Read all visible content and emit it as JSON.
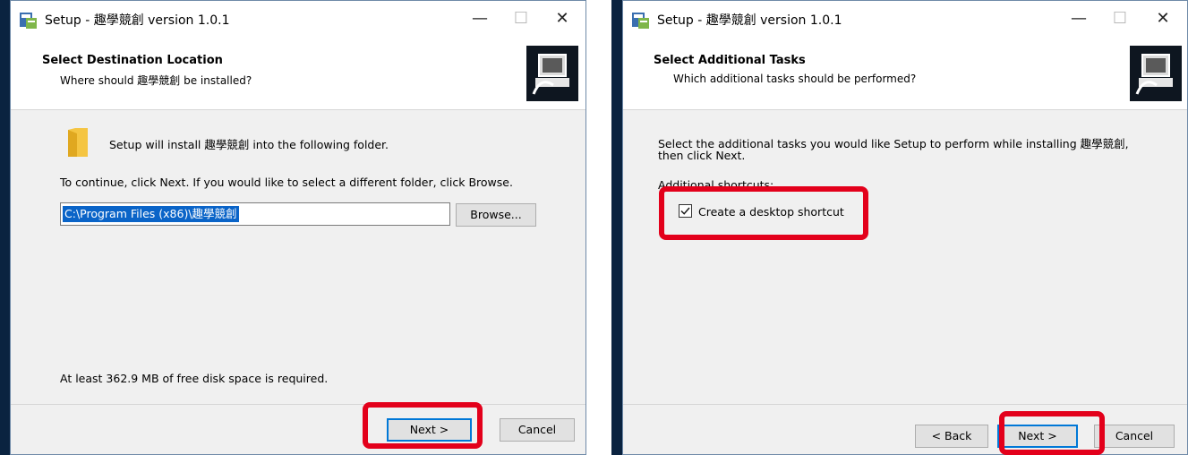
{
  "left": {
    "title": "Setup - 趣學競創 version 1.0.1",
    "controls": {
      "minimize": "—",
      "maximize": "☐",
      "close": "✕"
    },
    "header_title": "Select Destination Location",
    "header_subtitle": "Where should 趣學競創 be installed?",
    "install_text": "Setup will install 趣學競創 into the following folder.",
    "continue_text": "To continue, click Next. If you would like to select a different folder, click Browse.",
    "path_value": "C:\\Program Files (x86)\\趣學競創",
    "browse_label": "Browse...",
    "disk_space_text": "At least 362.9 MB of free disk space is required.",
    "next_label": "Next >",
    "cancel_label": "Cancel"
  },
  "right": {
    "title": "Setup - 趣學競創 version 1.0.1",
    "controls": {
      "minimize": "—",
      "maximize": "☐",
      "close": "✕"
    },
    "header_title": "Select Additional Tasks",
    "header_subtitle": "Which additional tasks should be performed?",
    "tasks_text_line1": "Select the additional tasks you would like Setup to perform while installing 趣學競創,",
    "tasks_text_line2": "then click Next.",
    "shortcuts_label": "Additional shortcuts:",
    "checkbox_label": "Create a desktop shortcut",
    "checkbox_checked": true,
    "back_label": "< Back",
    "next_label": "Next >",
    "cancel_label": "Cancel"
  },
  "colors": {
    "highlight": "#e3001b",
    "selection": "#0a64c8",
    "default_button_border": "#0078d7"
  }
}
